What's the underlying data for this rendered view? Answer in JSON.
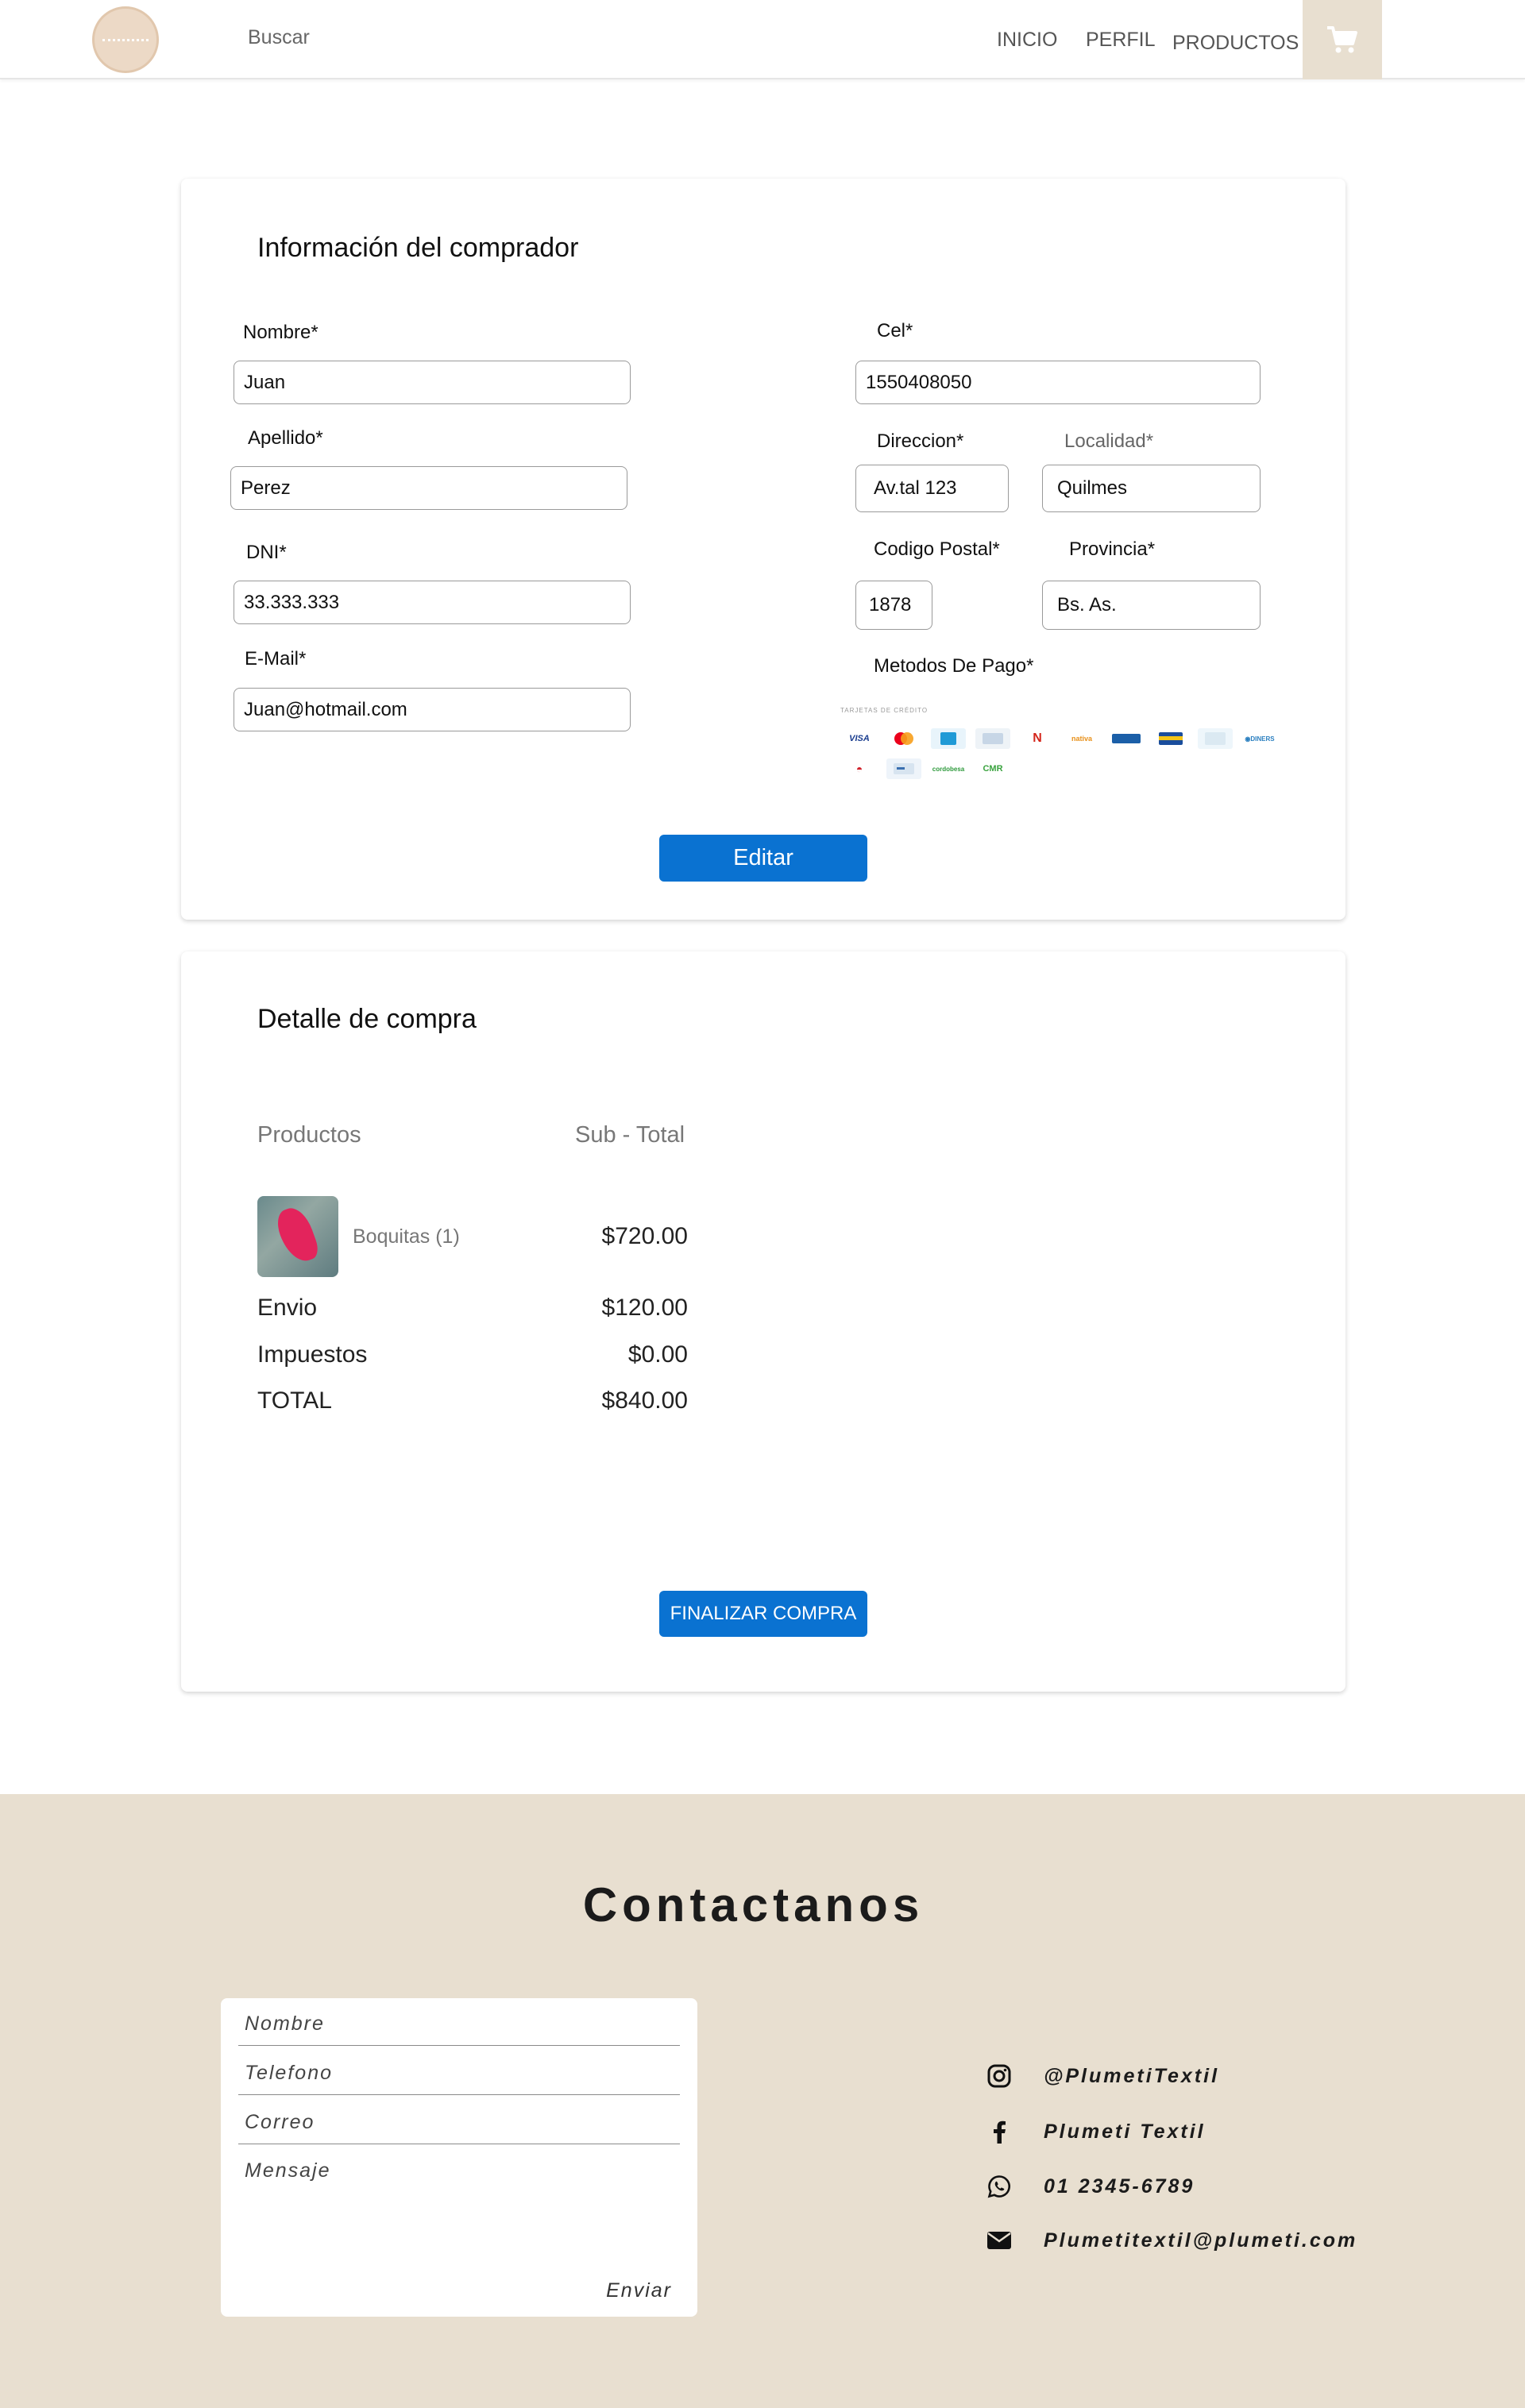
{
  "header": {
    "search_label": "Buscar",
    "nav": [
      "INICIO",
      "PERFIL",
      "PRODUCTOS"
    ],
    "cart_icon": "shopping-cart-icon"
  },
  "buyer": {
    "title": "Información del comprador",
    "nombre_label": "Nombre*",
    "nombre_value": "Juan",
    "apellido_label": "Apellido*",
    "apellido_value": "Perez",
    "dni_label": "DNI*",
    "dni_value": "33.333.333",
    "email_label": "E-Mail*",
    "email_value": "Juan@hotmail.com",
    "cel_label": "Cel*",
    "cel_value": "1550408050",
    "direccion_label": "Direccion*",
    "direccion_value": "Av.tal 123",
    "localidad_label": "Localidad*",
    "localidad_value": "Quilmes",
    "cp_label": "Codigo Postal*",
    "cp_value": "1878",
    "provincia_label": "Provincia*",
    "provincia_value": "Bs. As.",
    "pago_label": "Metodos De Pago*",
    "pago_caption": "TARJETAS DE CRÉDITO",
    "edit_button": "Editar"
  },
  "detail": {
    "title": "Detalle de compra",
    "col_products": "Productos",
    "col_subtotal": "Sub - Total",
    "product_name": "Boquitas (1)",
    "product_price": "$720.00",
    "envio_label": "Envio",
    "envio_value": "$120.00",
    "impuestos_label": "Impuestos",
    "impuestos_value": "$0.00",
    "total_label": "TOTAL",
    "total_value": "$840.00",
    "finish_button": "FINALIZAR COMPRA"
  },
  "footer": {
    "title": "Contactanos",
    "form": {
      "nombre": "Nombre",
      "telefono": "Telefono",
      "correo": "Correo",
      "mensaje": "Mensaje",
      "enviar": "Enviar"
    },
    "contacts": {
      "instagram": "@PlumetiTextil",
      "facebook": "Plumeti Textil",
      "whatsapp": "01 2345-6789",
      "email": "Plumetitextil@plumeti.com"
    }
  },
  "colors": {
    "accent_blue": "#0a72d1",
    "beige": "#e8dfd0"
  }
}
